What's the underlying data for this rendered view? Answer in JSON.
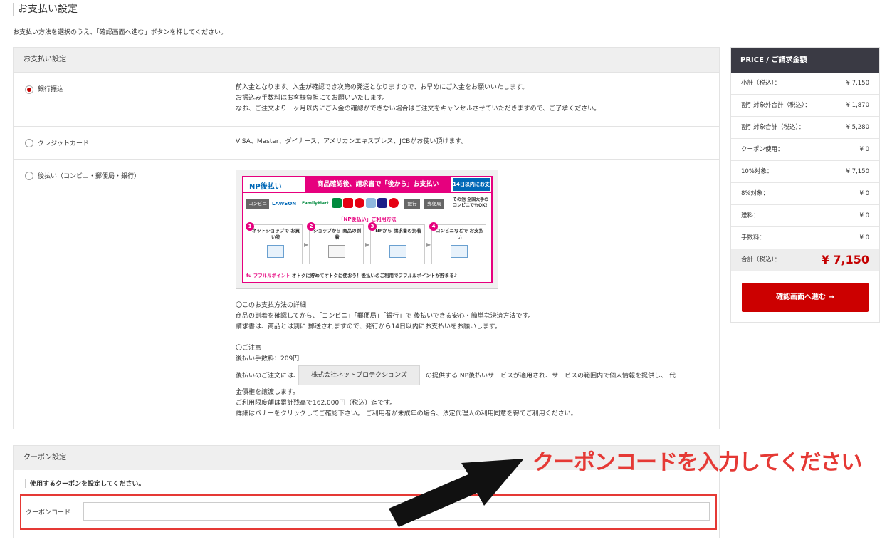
{
  "page": {
    "title": "お支払い設定",
    "description": "お支払い方法を選択のうえ、「確認画面へ進む」ボタンを押してください。"
  },
  "payment": {
    "header": "お支払い設定",
    "options": [
      {
        "label": "銀行振込",
        "selected": true,
        "desc": [
          "前入金となります。入金が確認でき次第の発送となりますので、お早めにご入金をお願いいたします。",
          "お振込み手数料はお客様負担にてお願いいたします。",
          "なお、ご注文よりーヶ月以内にご入金の確認ができない場合はご注文をキャンセルさせていただきますので、ご了承ください。"
        ]
      },
      {
        "label": "クレジットカード",
        "selected": false,
        "desc": [
          "VISA、Master、ダイナース、アメリカンエキスプレス、JCBがお使い頂けます。"
        ]
      },
      {
        "label": "後払い（コンビニ・郵便局・銀行）",
        "selected": false
      }
    ],
    "np_banner": {
      "logo": "NP後払い",
      "slogan": "商品確認後、請求書で「後から」お支払い",
      "badge": "14日以内にお支払い",
      "chips": [
        "コンビニ",
        "銀行",
        "郵便局"
      ],
      "stores": [
        "LAWSON",
        "FamilyMart"
      ],
      "ok_text": "その他 全国大手の コンビニでもOK!",
      "usage_title": "「NP後払い」ご利用方法",
      "steps": [
        {
          "num": "1",
          "text": "ネットショップで お買い物"
        },
        {
          "num": "2",
          "text": "ショップから 商品の到着"
        },
        {
          "num": "3",
          "text": "NPから 請求書の到着"
        },
        {
          "num": "4",
          "text": "コンビニなどで お支払い"
        }
      ],
      "bottom_brand": "fu フフルルポイント",
      "bottom_text": "オトクに貯めてオトクに使おう！後払いのご利用でフフルルポイントが貯まる♪"
    },
    "details": {
      "heading": "〇このお支払方法の詳細",
      "line1": "商品の到着を確認してから、「コンビニ」「郵便局」「銀行」で 後払いできる安心・簡単な決済方法です。",
      "line2": "請求書は、商品とは別に 郵送されますので、発行から14日以内にお支払いをお願いします。",
      "notice_heading": "〇ご注意",
      "fee": "後払い手数料：209円",
      "line3_pre": "後払いのご注文には、",
      "company": "株式会社ネットプロテクションズ",
      "line3_post": "の提供する NP後払いサービスが適用され、サービスの範囲内で個人情報を提供し、 代",
      "line4": "金債権を譲渡します。",
      "line5": "ご利用限度額は累計残高で162,000円（税込）迄です。",
      "line6": "詳細はバナーをクリックしてご確認下さい。 ご利用者が未成年の場合、法定代理人の利用同意を得てご利用ください。"
    }
  },
  "coupon": {
    "header": "クーポン設定",
    "subheading": "使用するクーポンを設定してください。",
    "label": "クーポンコード",
    "value": "",
    "placeholder": ""
  },
  "annotation": {
    "text": "クーポンコードを入力してください",
    "color": "#e53935"
  },
  "price": {
    "header": "PRICE / ご請求金額",
    "rows": [
      {
        "label": "小計（税込）：",
        "value": "¥ 7,150"
      },
      {
        "label": "割引対象外合計（税込）：",
        "value": "¥ 1,870"
      },
      {
        "label": "割引対象合計（税込）：",
        "value": "¥ 5,280"
      },
      {
        "label": "クーポン使用：",
        "value": "¥ 0"
      },
      {
        "label": "10%対象：",
        "value": "¥ 7,150"
      },
      {
        "label": "8%対象：",
        "value": "¥ 0"
      },
      {
        "label": "送料：",
        "value": "¥ 0"
      },
      {
        "label": "手数料：",
        "value": "¥ 0"
      }
    ],
    "total_label": "合計（税込）：",
    "total_value": "¥ 7,150",
    "confirm_button": "確認画面へ進む →",
    "accent_color": "#cc0000"
  }
}
